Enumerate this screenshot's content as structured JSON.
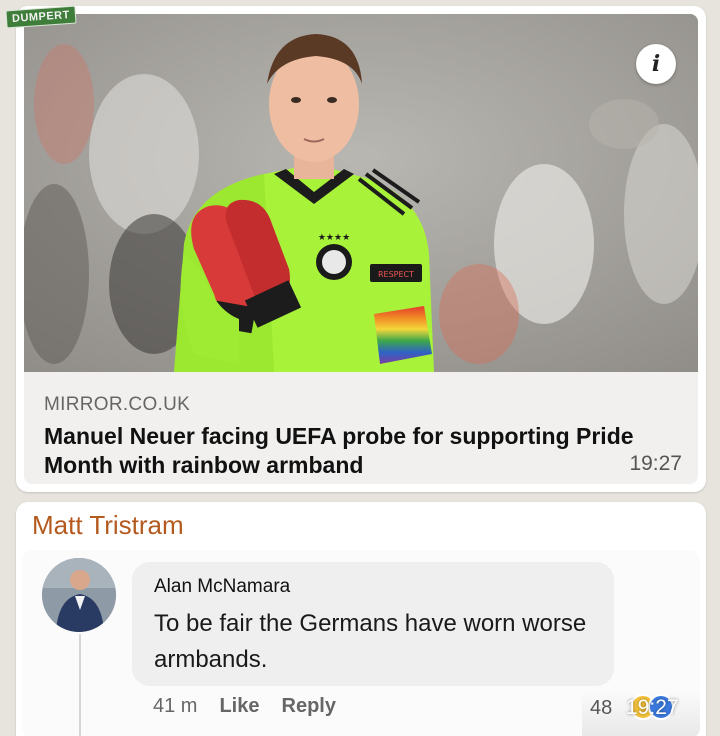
{
  "watermark": "DUMPERT",
  "link_preview": {
    "source": "MIRROR.CO.UK",
    "title": "Manuel Neuer facing UEFA probe for supporting Pride Month with rainbow armband",
    "timestamp": "19:27",
    "info_icon_glyph": "i",
    "info_icon_name": "info-icon",
    "armband_text": "RESPECT"
  },
  "message": {
    "sender": "Matt Tristram",
    "sender_color": "#b45a1e",
    "timestamp": "19:27",
    "comment": {
      "author": "Alan McNamara",
      "text": "To be fair the Germans have worn worse armbands.",
      "age": "41 m",
      "like_label": "Like",
      "reply_label": "Reply",
      "reaction_count": "48"
    }
  }
}
